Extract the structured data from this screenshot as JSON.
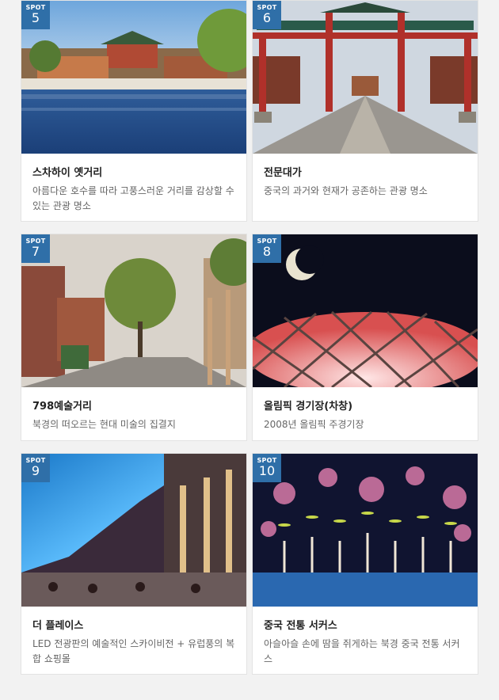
{
  "spots": [
    {
      "badge": "SPOT",
      "number": "5",
      "title": "스차하이 옛거리",
      "desc": "아름다운 호수를 따라 고풍스러운 거리를 감상할 수 있는 관광 명소"
    },
    {
      "badge": "SPOT",
      "number": "6",
      "title": "전문대가",
      "desc": "중국의 과거와 현재가 공존하는 관광 명소"
    },
    {
      "badge": "SPOT",
      "number": "7",
      "title": "798예술거리",
      "desc": "북경의 떠오르는 현대 미술의 집결지"
    },
    {
      "badge": "SPOT",
      "number": "8",
      "title": "올림픽 경기장(차창)",
      "desc": "2008년 올림픽 주경기장"
    },
    {
      "badge": "SPOT",
      "number": "9",
      "title": "더 플레이스",
      "desc": "LED 전광판의 예술적인 스카이비전 + 유럽풍의 복합 쇼핑몰"
    },
    {
      "badge": "SPOT",
      "number": "10",
      "title": "중국 전통 서커스",
      "desc": "아슬아슬 손에 땀을 쥐게하는 북경 중국 전통 서커스"
    }
  ]
}
